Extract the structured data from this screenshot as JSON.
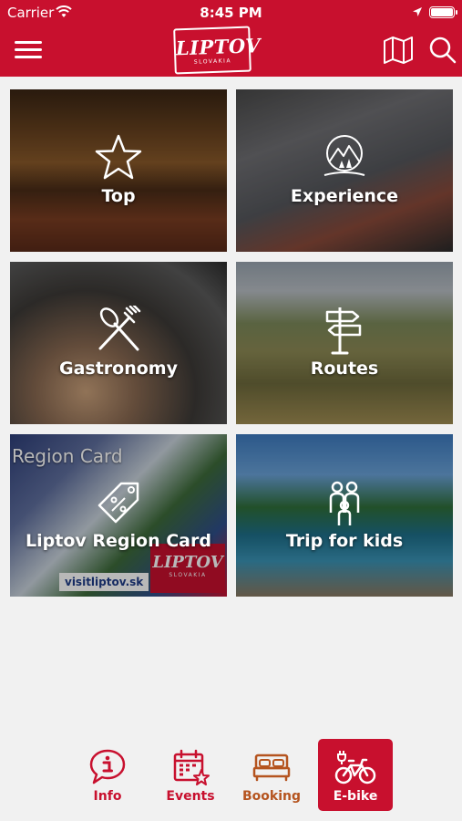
{
  "status_bar": {
    "carrier": "Carrier",
    "time": "8:45 PM"
  },
  "header": {
    "menu_icon": "hamburger-menu-icon",
    "logo_text": "LIPTOV",
    "logo_subtext": "SLOVAKIA",
    "map_icon": "map-icon",
    "search_icon": "search-icon"
  },
  "tiles": [
    {
      "label": "Top",
      "icon": "star-icon"
    },
    {
      "label": "Experience",
      "icon": "landscape-icon"
    },
    {
      "label": "Gastronomy",
      "icon": "spoon-fork-icon"
    },
    {
      "label": "Routes",
      "icon": "signpost-icon"
    },
    {
      "label": "Liptov Region Card",
      "icon": "discount-tag-icon"
    },
    {
      "label": "Trip for kids",
      "icon": "family-icon"
    }
  ],
  "region_card": {
    "title": "Region Card",
    "site": "visitliptov.sk",
    "badge_word": "LIPTOV",
    "badge_sub": "SLOVAKIA"
  },
  "tab_bar": {
    "active": "E-bike",
    "tabs": [
      {
        "label": "Info",
        "icon": "info-icon"
      },
      {
        "label": "Events",
        "icon": "calendar-icon"
      },
      {
        "label": "Booking",
        "icon": "bed-icon"
      },
      {
        "label": "E-bike",
        "icon": "ebike-icon"
      }
    ]
  },
  "colors": {
    "brand_red": "#c8102e",
    "booking_label": "#b5541f",
    "background": "#f1f1f1"
  }
}
